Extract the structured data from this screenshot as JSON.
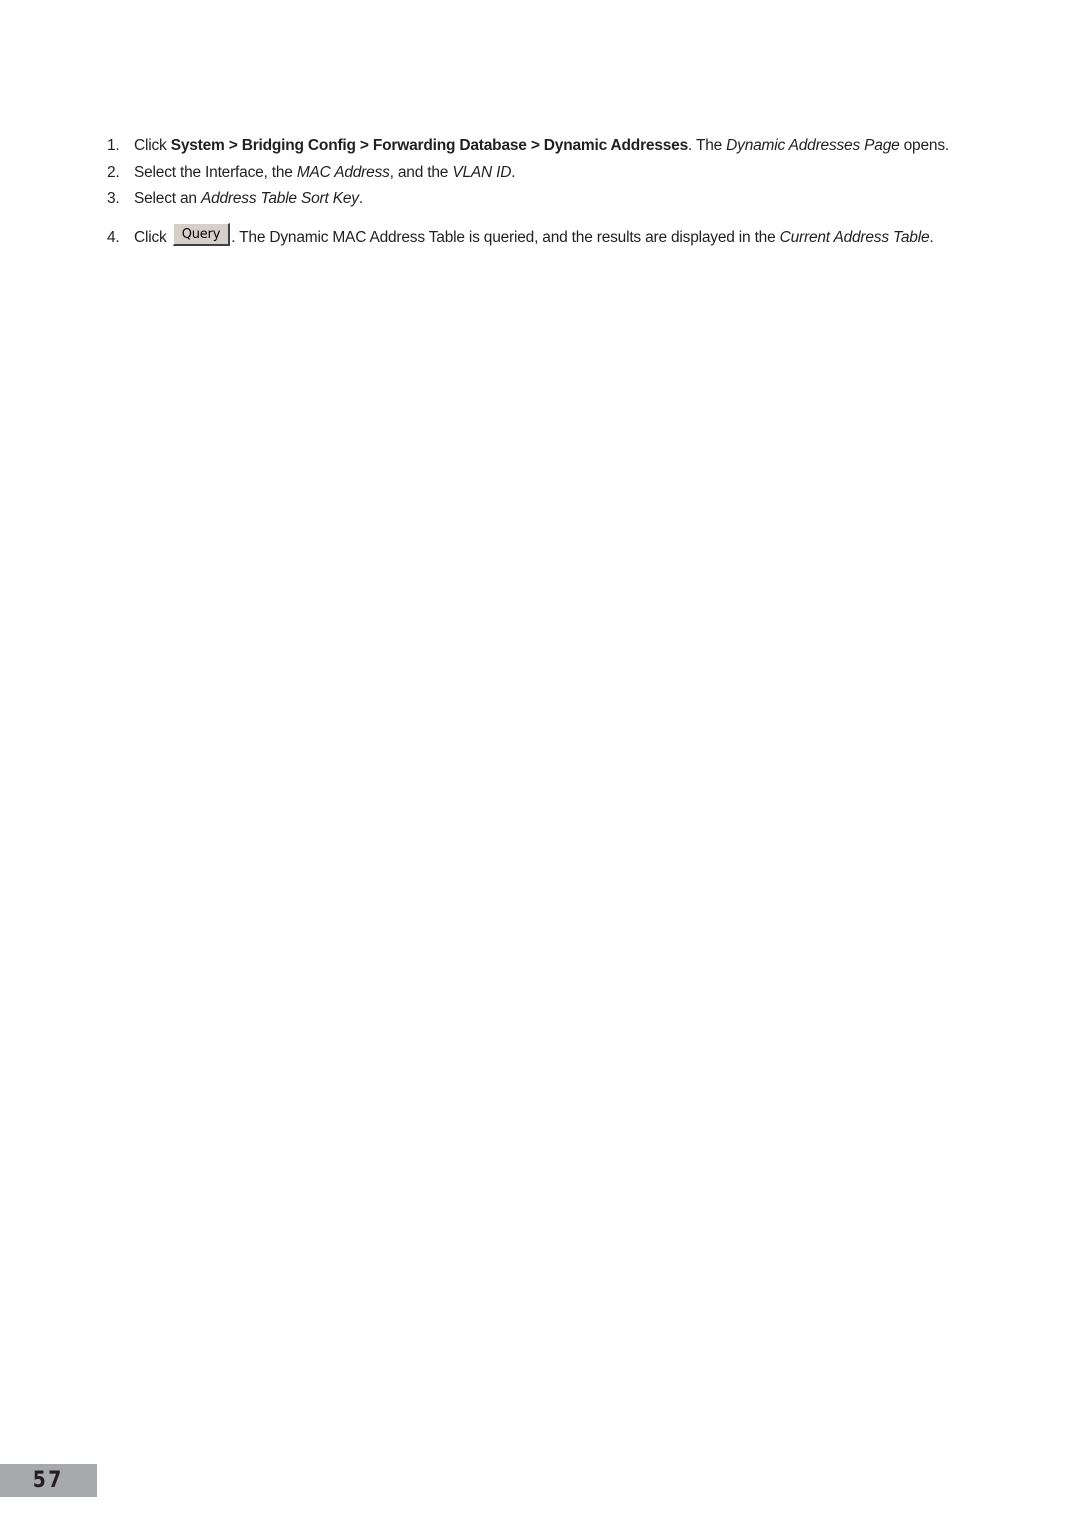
{
  "steps": [
    {
      "number": "1.",
      "prefix": "Click ",
      "path_system": "System",
      "sep1": " > ",
      "path_bridging": "Bridging Config",
      "sep2": " > ",
      "path_fdb": "Forwarding Database",
      "sep3": " > ",
      "path_dynamic": "Dynamic Addresses",
      "middle": ". The ",
      "page_name": "Dynamic Addresses Page",
      "suffix": " opens."
    },
    {
      "number": "2.",
      "text_a": "Select the Interface, the ",
      "mac_address": "MAC Address",
      "text_b": ", and the ",
      "vlan_id": "VLAN ID",
      "text_c": "."
    },
    {
      "number": "3.",
      "text_a": "Select an ",
      "sort_key": "Address Table Sort Key",
      "text_b": "."
    },
    {
      "number": "4.",
      "prefix": "Click ",
      "button_label": "Query",
      "text_a": ". The Dynamic MAC Address Table is queried, and the results are displayed in the ",
      "table_name": "Current Address Table",
      "text_b": "."
    }
  ],
  "page_number": "57"
}
